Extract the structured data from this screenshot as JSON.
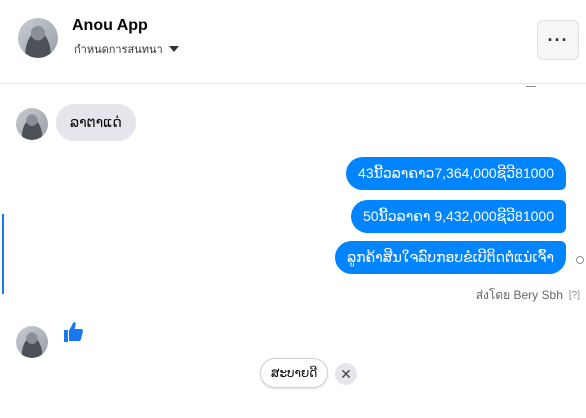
{
  "header": {
    "contact_name": "Anou App",
    "subtitle": "กำหนดการสนทนา",
    "more_label": "···"
  },
  "messages": {
    "received_1": "ລາຕາແດ່",
    "sent": [
      "43ນີ້ວລາຄາວ7,364,000ຊີວີ81000",
      "50ນີ້ວລາຄາ 9,432,000ຊີວີ81000",
      "ລູກຄ້າສີນໃຈລົບກອບຂໍເບີຕິດຕໍ່ແນ່ເຈົ້າ"
    ],
    "sent_by": "ส่งโดย Bery Sbh",
    "help_mark": "[?]"
  },
  "composer": {
    "chip_label": "ສະບາຍດີ",
    "chip_close": "✕"
  },
  "colors": {
    "accent": "#0084ff",
    "bubble_in": "#e4e6eb",
    "like": "#1877f2"
  }
}
